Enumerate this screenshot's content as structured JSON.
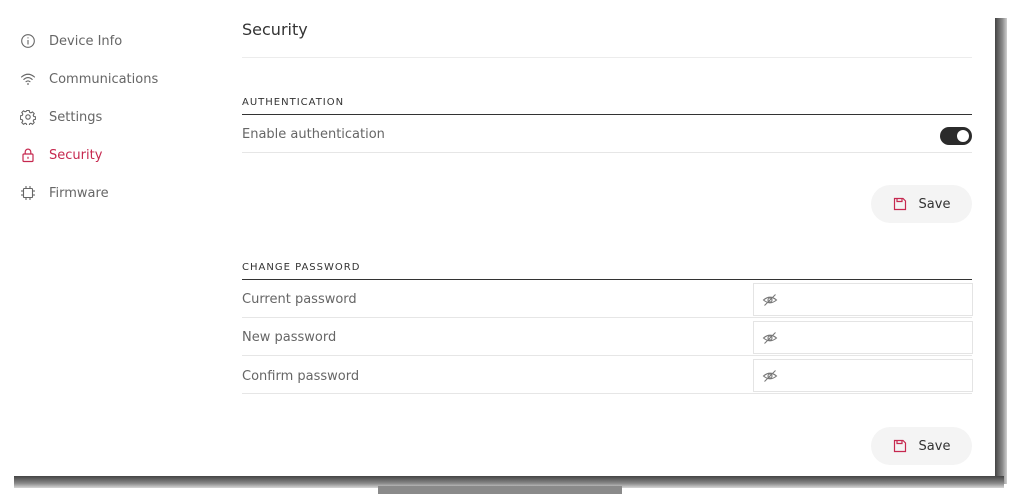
{
  "colors": {
    "accent": "#c6284f",
    "toggle_on": "#2b2b2b",
    "button_bg": "#f4f4f4"
  },
  "sidebar": {
    "items": [
      {
        "label": "Device Info",
        "icon": "info-icon",
        "active": false
      },
      {
        "label": "Communications",
        "icon": "wifi-icon",
        "active": false
      },
      {
        "label": "Settings",
        "icon": "gear-icon",
        "active": false
      },
      {
        "label": "Security",
        "icon": "lock-icon",
        "active": true
      },
      {
        "label": "Firmware",
        "icon": "chip-icon",
        "active": false
      }
    ]
  },
  "main": {
    "title": "Security",
    "authentication": {
      "heading": "AUTHENTICATION",
      "enable_label": "Enable authentication",
      "enabled": true,
      "save_label": "Save"
    },
    "change_password": {
      "heading": "CHANGE PASSWORD",
      "fields": [
        {
          "label": "Current password",
          "value": ""
        },
        {
          "label": "New password",
          "value": ""
        },
        {
          "label": "Confirm password",
          "value": ""
        }
      ],
      "save_label": "Save"
    }
  }
}
